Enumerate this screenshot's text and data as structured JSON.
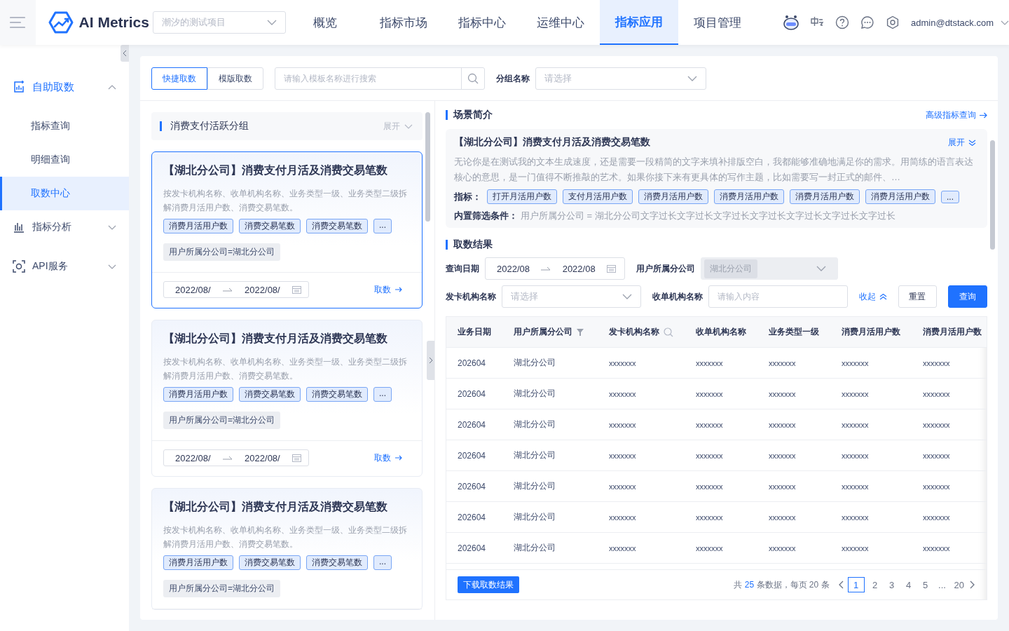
{
  "header": {
    "logo": "AI Metrics",
    "project_select": {
      "placeholder": "潮汐的测试项目"
    },
    "nav": [
      {
        "label": "概览",
        "selected": false
      },
      {
        "label": "指标市场",
        "selected": false
      },
      {
        "label": "指标中心",
        "selected": false
      },
      {
        "label": "运维中心",
        "selected": false
      },
      {
        "label": "指标应用",
        "selected": true
      },
      {
        "label": "项目管理",
        "selected": false
      }
    ],
    "user": "admin@dtstack.com"
  },
  "sidebar": {
    "items": [
      {
        "label": "自助取数",
        "expanded": true,
        "children": [
          {
            "label": "指标查询",
            "selected": false
          },
          {
            "label": "明细查询",
            "selected": false
          },
          {
            "label": "取数中心",
            "selected": true
          }
        ]
      },
      {
        "label": "指标分析",
        "expanded": false
      },
      {
        "label": "API服务",
        "expanded": false
      }
    ]
  },
  "toolbar": {
    "modes": [
      {
        "label": "快捷取数",
        "selected": true
      },
      {
        "label": "模版取数",
        "selected": false
      }
    ],
    "search": {
      "placeholder": "请输入模板名称进行搜索"
    },
    "group_label": "分组名称",
    "group_select": {
      "placeholder": "请选择"
    }
  },
  "group": {
    "title": "消费支付活跃分组",
    "toggle": "展开"
  },
  "cards": [
    {
      "selected": true,
      "title": "【湖北分公司】消费支付月活及消费交易笔数",
      "description": "按发卡机构名称、收单机构名称、业务类型一级、业务类型二级拆解消费月活用户数、消费交易笔数。",
      "tags": [
        "消费月活用户数",
        "消费交易笔数",
        "消费交易笔数",
        "..."
      ],
      "filter": "用户所属分公司=湖北分公司",
      "date_from": "2022/08/",
      "date_to": "2022/08/",
      "action": "取数"
    },
    {
      "selected": false,
      "title": "【湖北分公司】消费支付月活及消费交易笔数",
      "description": "按发卡机构名称、收单机构名称、业务类型一级、业务类型二级拆解消费月活用户数、消费交易笔数。",
      "tags": [
        "消费月活用户数",
        "消费交易笔数",
        "消费交易笔数",
        "..."
      ],
      "filter": "用户所属分公司=湖北分公司",
      "date_from": "2022/08/",
      "date_to": "2022/08/",
      "action": "取数"
    },
    {
      "selected": false,
      "title": "【湖北分公司】消费支付月活及消费交易笔数",
      "description": "按发卡机构名称、收单机构名称、业务类型一级、业务类型二级拆解消费月活用户数、消费交易笔数。",
      "tags": [
        "消费月活用户数",
        "消费交易笔数",
        "消费交易笔数",
        "..."
      ],
      "filter": "用户所属分公司=湖北分公司"
    }
  ],
  "scene": {
    "title": "场景简介",
    "link": "高级指标查询",
    "name": "【湖北分公司】消费支付月活及消费交易笔数",
    "toggle": "展开",
    "description": "无论你是在测试我的文本生成速度，还是需要一段精简的文字来填补排版空白，我都能够准确地满足你的需求。用简练的语言表达核心的意思，是一门值得不断推敲的艺术。如果你接下来有更具体的写作主题，比如需要写一封正式的邮件、…",
    "metrics_label": "指标：",
    "metrics": [
      "打开月活用户数",
      "支付月活用户数",
      "消费月活用户数",
      "消费月活用户数",
      "消费月活用户数",
      "消费月活用户数",
      "..."
    ],
    "filter_label": "内置筛选条件：",
    "filter": "用户所属分公司 = 湖北分公司文字过长文字过长文字过长文字过长文字过长文字过长文字过长"
  },
  "results": {
    "title": "取数结果",
    "filters": {
      "date_label": "查询日期",
      "date_from": "2022/08",
      "date_to": "2022/08",
      "branch_label": "用户所属分公司",
      "branch_value": "湖北分公司",
      "issuer_label": "发卡机构名称",
      "issuer_placeholder": "请选择",
      "acquirer_label": "收单机构名称",
      "acquirer_placeholder": "请输入内容",
      "collapse": "收起",
      "reset": "重置",
      "query": "查询"
    },
    "table": {
      "columns": [
        {
          "label": "业务日期",
          "kind": "plain"
        },
        {
          "label": "用户所属分公司",
          "kind": "filter"
        },
        {
          "label": "发卡机构名称",
          "kind": "search"
        },
        {
          "label": "收单机构名称",
          "kind": "plain"
        },
        {
          "label": "业务类型一级",
          "kind": "plain"
        },
        {
          "label": "消费月活用户数",
          "kind": "plain"
        },
        {
          "label": "消费月活用户数",
          "kind": "plain"
        }
      ],
      "rows": [
        [
          "202604",
          "湖北分公司",
          "xxxxxxx",
          "xxxxxxx",
          "xxxxxxx",
          "xxxxxxx",
          "xxxxxxx"
        ],
        [
          "202604",
          "湖北分公司",
          "xxxxxxx",
          "xxxxxxx",
          "xxxxxxx",
          "xxxxxxx",
          "xxxxxxx"
        ],
        [
          "202604",
          "湖北分公司",
          "xxxxxxx",
          "xxxxxxx",
          "xxxxxxx",
          "xxxxxxx",
          "xxxxxxx"
        ],
        [
          "202604",
          "湖北分公司",
          "xxxxxxx",
          "xxxxxxx",
          "xxxxxxx",
          "xxxxxxx",
          "xxxxxxx"
        ],
        [
          "202604",
          "湖北分公司",
          "xxxxxxx",
          "xxxxxxx",
          "xxxxxxx",
          "xxxxxxx",
          "xxxxxxx"
        ],
        [
          "202604",
          "湖北分公司",
          "xxxxxxx",
          "xxxxxxx",
          "xxxxxxx",
          "xxxxxxx",
          "xxxxxxx"
        ],
        [
          "202604",
          "湖北分公司",
          "xxxxxxx",
          "xxxxxxx",
          "xxxxxxx",
          "xxxxxxx",
          "xxxxxxx"
        ]
      ]
    },
    "download": "下载取数结果",
    "pagination": {
      "total_prefix": "共",
      "total": "25",
      "total_suffix": "条数据，每页 20 条",
      "pages": [
        {
          "label": "1",
          "selected": true
        },
        {
          "label": "2",
          "selected": false
        },
        {
          "label": "3",
          "selected": false
        },
        {
          "label": "4",
          "selected": false
        },
        {
          "label": "5",
          "selected": false
        },
        {
          "label": "...",
          "selected": false
        },
        {
          "label": "20",
          "selected": false
        }
      ]
    }
  }
}
